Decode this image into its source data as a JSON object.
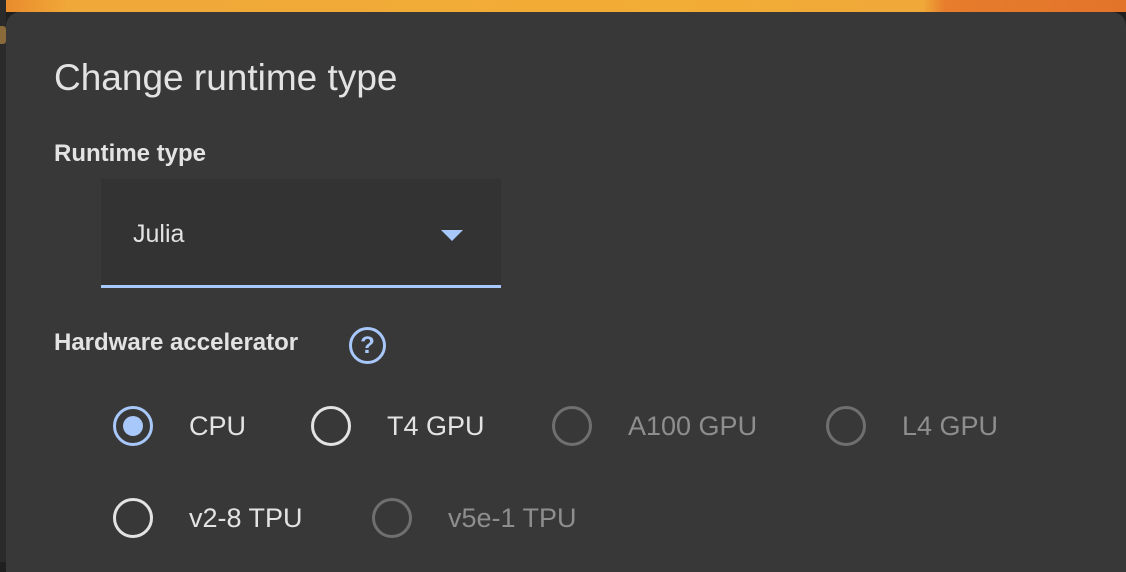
{
  "dialog": {
    "title": "Change runtime type"
  },
  "runtime": {
    "label": "Runtime type",
    "selected_value": "Julia",
    "dropdown_icon": "arrow-drop-down-icon"
  },
  "accelerator": {
    "label": "Hardware accelerator",
    "help_icon_glyph": "?",
    "help_icon": "help-circle-icon",
    "options": [
      {
        "label": "CPU",
        "selected": true,
        "enabled": true
      },
      {
        "label": "T4 GPU",
        "selected": false,
        "enabled": true
      },
      {
        "label": "A100 GPU",
        "selected": false,
        "enabled": false
      },
      {
        "label": "L4 GPU",
        "selected": false,
        "enabled": false
      },
      {
        "label": "v2-8 TPU",
        "selected": false,
        "enabled": true
      },
      {
        "label": "v5e-1 TPU",
        "selected": false,
        "enabled": false
      }
    ]
  },
  "colors": {
    "dialog_background": "#383838",
    "accent": "#a8c7fa",
    "text": "#e3e3e3",
    "disabled_text": "#8e8e8e",
    "top_banner": "#f2ad36"
  }
}
